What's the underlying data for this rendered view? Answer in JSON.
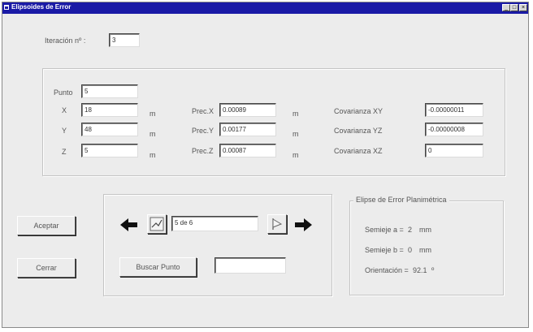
{
  "window": {
    "title": "Elipsoides de Error",
    "controls": [
      "_",
      "□",
      "×"
    ]
  },
  "iteration": {
    "label": "Iteración nº :",
    "value": "3"
  },
  "point": {
    "label": "Punto",
    "value": "5",
    "x_label": "X",
    "x_value": "18",
    "x_unit": "m",
    "y_label": "Y",
    "y_value": "48",
    "y_unit": "m",
    "z_label": "Z",
    "z_value": "5",
    "z_unit": "m"
  },
  "precision": {
    "x_label": "Prec.X",
    "x_value": "0.00089",
    "x_unit": "m",
    "y_label": "Prec.Y",
    "y_value": "0.00177",
    "y_unit": "m",
    "z_label": "Prec.Z",
    "z_value": "0.00087",
    "z_unit": "m"
  },
  "covariance": {
    "xy_label": "Covarianza XY",
    "xy_value": "-0.00000011",
    "yz_label": "Covarianza YZ",
    "yz_value": "-0.00000008",
    "xz_label": "Covarianza XZ",
    "xz_value": "0"
  },
  "buttons": {
    "accept": "Aceptar",
    "close": "Cerrar",
    "search": "Buscar Punto"
  },
  "navigator": {
    "position": "5 de 6",
    "search_value": ""
  },
  "ellipse": {
    "title": "Elipse de Error Planimétrica",
    "semi_a_label": "Semieje a =",
    "semi_a_value": "2",
    "semi_a_unit": "mm",
    "semi_b_label": "Semieje b =",
    "semi_b_value": "0",
    "semi_b_unit": "mm",
    "orient_label": "Orientación =",
    "orient_value": "92.1",
    "orient_unit": "º"
  },
  "icons": {
    "prev": "arrow-left-icon",
    "next": "arrow-right-icon",
    "chart": "line-chart-icon",
    "flag": "flag-icon"
  }
}
